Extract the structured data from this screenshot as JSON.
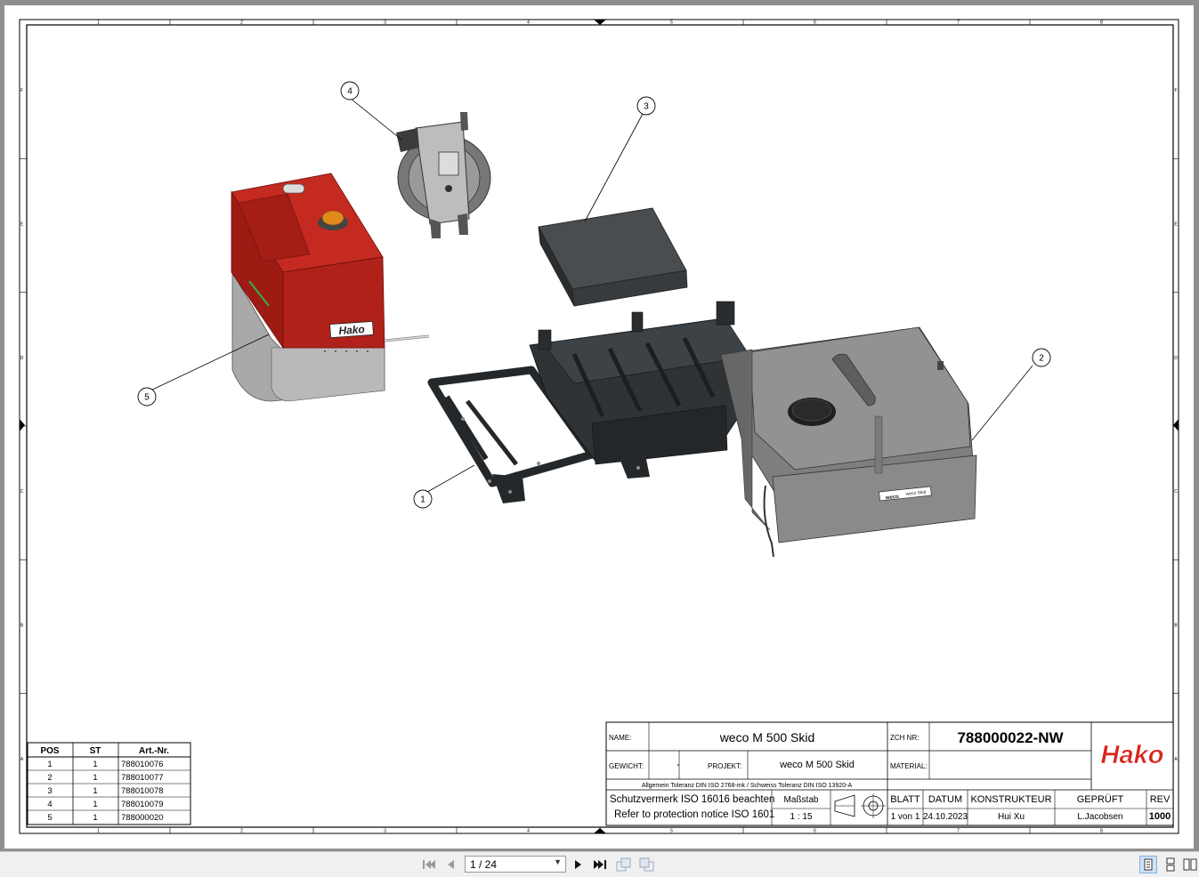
{
  "viewer": {
    "page_indicator": "1 / 24",
    "buttons": {
      "first": "first-page",
      "prev": "previous-page",
      "next": "next-page",
      "last": "last-page"
    }
  },
  "drawing": {
    "callouts": [
      "1",
      "2",
      "3",
      "4",
      "5"
    ],
    "frame_columns": [
      "1",
      "2",
      "3",
      "4",
      "5",
      "6",
      "7",
      "8"
    ],
    "frame_rows": [
      "F",
      "E",
      "D",
      "C",
      "B",
      "A"
    ],
    "parts_list": {
      "headers": [
        "POS",
        "ST",
        "Art.-Nr."
      ],
      "rows": [
        [
          "1",
          "1",
          "788010076"
        ],
        [
          "2",
          "1",
          "788010077"
        ],
        [
          "3",
          "1",
          "788010078"
        ],
        [
          "4",
          "1",
          "788010079"
        ],
        [
          "5",
          "1",
          "788000020"
        ]
      ]
    },
    "title_block": {
      "name_label": "NAME:",
      "name_value": "weco M 500 Skid",
      "zch_label": "ZCH NR:",
      "zch_value": "788000022-NW",
      "gewicht_label": "GEWICHT:",
      "gewicht_value": "-",
      "projekt_label": "PROJEKT:",
      "projekt_value": "weco M 500 Skid",
      "material_label": "MATERIAL:",
      "material_value": "",
      "tolerance_note": "Allgemein Toleranz DIN ISO 2768-mk / Schweiss Toleranz DIN ISO 13920-A",
      "protection_de": "Schutzvermerk  ISO 16016 beachten",
      "protection_en": "Refer to protection notice ISO 1601",
      "massstab_label": "Maßstab",
      "massstab_value": "1 : 15",
      "blatt_label": "BLATT",
      "blatt_value": "1 von 1",
      "datum_label": "DATUM",
      "datum_value": "24.10.2023",
      "konstrukteur_label": "KONSTRUKTEUR",
      "konstrukteur_value": "Hui Xu",
      "geprueft_label": "GEPRÜFT",
      "geprueft_value": "L.Jacobsen",
      "rev_label": "REV",
      "rev_value": "1000",
      "logo_text": "Hako",
      "logo_color": "#d9241b"
    },
    "part_labels": {
      "engine_badge": "Hako",
      "tank_badge_left": "weco",
      "tank_badge_right": "weco Skid"
    }
  },
  "colors": {
    "engine_red": "#b8221a",
    "frame_dark": "#2f3336",
    "tank_grey": "#8c8c8c"
  }
}
